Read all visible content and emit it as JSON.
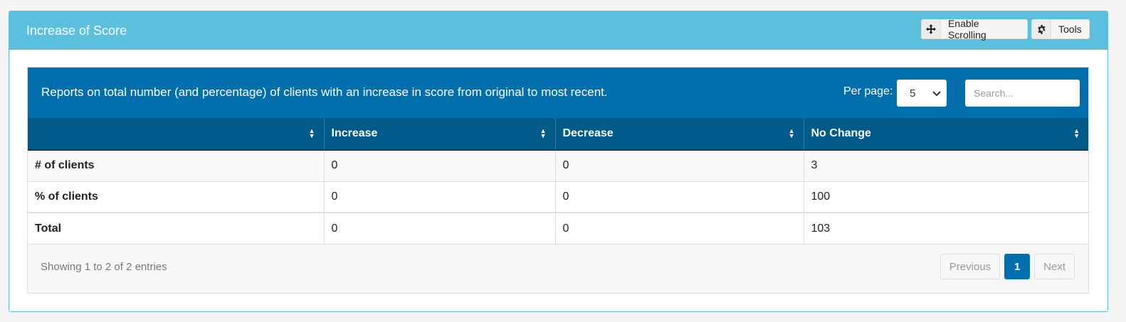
{
  "panel": {
    "title": "Increase of Score",
    "buttons": {
      "scroll_label": "Enable Scrolling",
      "tools_label": "Tools"
    }
  },
  "report": {
    "description": "Reports on total number (and percentage) of clients with an increase in score from original to most recent.",
    "per_page_label": "Per page:",
    "per_page_value": "5",
    "search_placeholder": "Search..."
  },
  "table": {
    "headers": [
      "",
      "Increase",
      "Decrease",
      "No Change"
    ],
    "rows": [
      {
        "label": "# of clients",
        "increase": "0",
        "decrease": "0",
        "no_change": "3"
      },
      {
        "label": "% of clients",
        "increase": "0",
        "decrease": "0",
        "no_change": "100"
      }
    ],
    "total": {
      "label": "Total",
      "increase": "0",
      "decrease": "0",
      "no_change": "103"
    }
  },
  "footer": {
    "info": "Showing 1 to 2 of 2 entries",
    "pagination": {
      "previous": "Previous",
      "current": "1",
      "next": "Next"
    }
  },
  "colors": {
    "panel_header": "#5bc0de",
    "report_header": "#006fae",
    "table_header": "#005a8a",
    "active_page": "#006fae"
  }
}
